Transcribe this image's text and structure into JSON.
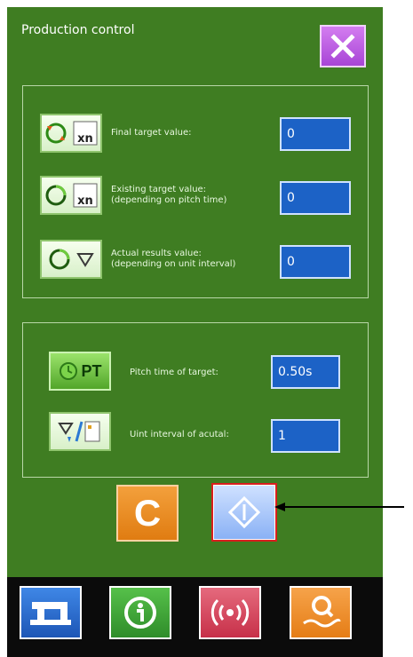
{
  "window": {
    "title": "Production control"
  },
  "counters": [
    {
      "label": "Final target value:",
      "value": "0",
      "icon": "counter-reset-icon"
    },
    {
      "label": "Existing target value:\n(depending on pitch time)",
      "value": "0",
      "icon": "pitch-counter-icon"
    },
    {
      "label": "Actual results value:\n(depending on unit interval)",
      "value": "0",
      "icon": "actual-results-icon"
    }
  ],
  "settings": [
    {
      "label": "Pitch time of target:",
      "value": "0.50s",
      "icon_text": "PT",
      "icon": "pitch-time-icon"
    },
    {
      "label": "Uint interval of acutal:",
      "value": "1",
      "icon": "unit-interval-icon"
    }
  ],
  "actions": {
    "clear_label": "C",
    "start_icon": "start-diamond-icon"
  },
  "colors": {
    "panel": "#3f7d22",
    "field": "#1c62c6",
    "close": "#b85ddf",
    "highlight": "#d91e1e"
  },
  "nav": [
    "sewing-machine-icon",
    "info-icon",
    "communication-icon",
    "search-icon"
  ]
}
